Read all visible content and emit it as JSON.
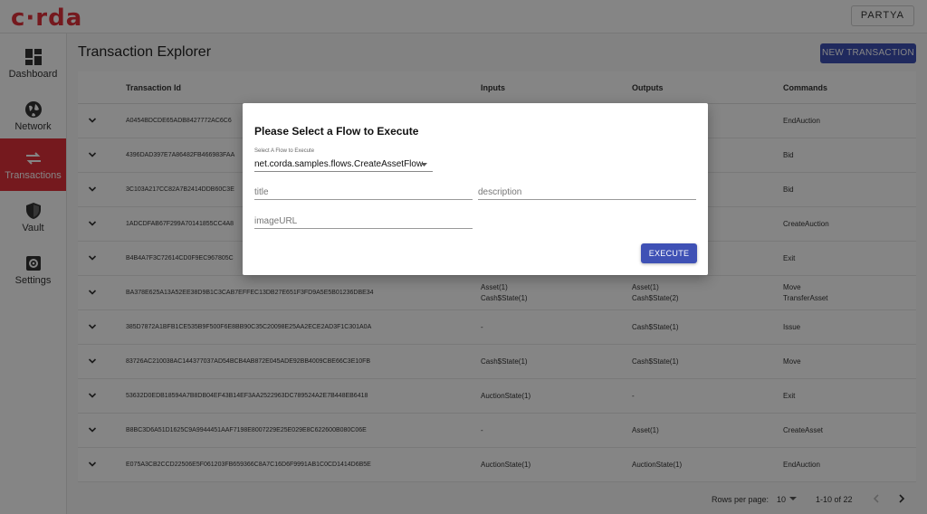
{
  "app": {
    "logo": "c·rda",
    "user": "PARTYA"
  },
  "sidebar": {
    "items": [
      {
        "label": "Dashboard"
      },
      {
        "label": "Network"
      },
      {
        "label": "Transactions"
      },
      {
        "label": "Vault"
      },
      {
        "label": "Settings"
      }
    ],
    "active": "Transactions"
  },
  "main": {
    "title": "Transaction Explorer",
    "new_button": "NEW TRANSACTION"
  },
  "table": {
    "headers": {
      "id": "Transaction Id",
      "inputs": "Inputs",
      "outputs": "Outputs",
      "commands": "Commands"
    },
    "rows": [
      {
        "id": "A0454BDCDE65ADB8427772AC6C6",
        "inputs": "",
        "outputs": "",
        "commands": "EndAuction"
      },
      {
        "id": "4396DAD397E7A86482FB466983FAA",
        "inputs": "",
        "outputs": "",
        "commands": "Bid"
      },
      {
        "id": "3C103A217CC82A7B2414DDB60C3E",
        "inputs": "",
        "outputs": "",
        "commands": "Bid"
      },
      {
        "id": "1ADCDFAB67F299A70141855CC4A8",
        "inputs": "",
        "outputs": "",
        "commands": "CreateAuction"
      },
      {
        "id": "B4B4A7F3C72614CD0F9EC967805C",
        "inputs": "",
        "outputs": "",
        "commands": "Exit"
      },
      {
        "id": "BA378E625A13A52EE38D9B1C3CAB7EFFEC13DB27E651F3FD9A5E5B01236DBE34",
        "inputs": "Asset(1)\nCash$State(1)",
        "outputs": "Asset(1)\nCash$State(2)",
        "commands": "Move\nTransferAsset"
      },
      {
        "id": "385D7872A1BFB1CE535B9F500F6E8BB90C35C20098E25AA2ECE2AD3F1C301A0A",
        "inputs": "-",
        "outputs": "Cash$State(1)",
        "commands": "Issue"
      },
      {
        "id": "83726AC210038AC144377037AD54BCB4AB872E045ADE92BB4009CBE66C3E10FB",
        "inputs": "Cash$State(1)",
        "outputs": "Cash$State(1)",
        "commands": "Move"
      },
      {
        "id": "53632D0EDB18594A7B8DB04EF43B14EF3AA2522963DC789524A2E7B448EB6418",
        "inputs": "AuctionState(1)",
        "outputs": "-",
        "commands": "Exit"
      },
      {
        "id": "B8BC3D6A51D1625C9A9944451AAF7198E8007229E25E029E8C622600B080C06E",
        "inputs": "-",
        "outputs": "Asset(1)",
        "commands": "CreateAsset"
      },
      {
        "id": "E075A3CB2CCD22506E5F061203FB659366C8A7C16D6F9991AB1C0CD1414D6B5E",
        "inputs": "AuctionState(1)",
        "outputs": "AuctionState(1)",
        "commands": "EndAuction"
      }
    ]
  },
  "pagination": {
    "rows_per_page_label": "Rows per page:",
    "rows_per_page": "10",
    "range": "1-10 of 22"
  },
  "dialog": {
    "title": "Please Select a Flow to Execute",
    "select_label": "Select A Flow to Execute",
    "select_value": "net.corda.samples.flows.CreateAssetFlow",
    "title_placeholder": "title",
    "description_placeholder": "description",
    "image_placeholder": "imageURL",
    "execute_label": "EXECUTE"
  },
  "colors": {
    "brand": "#e0313a",
    "primary": "#3f51b5"
  }
}
